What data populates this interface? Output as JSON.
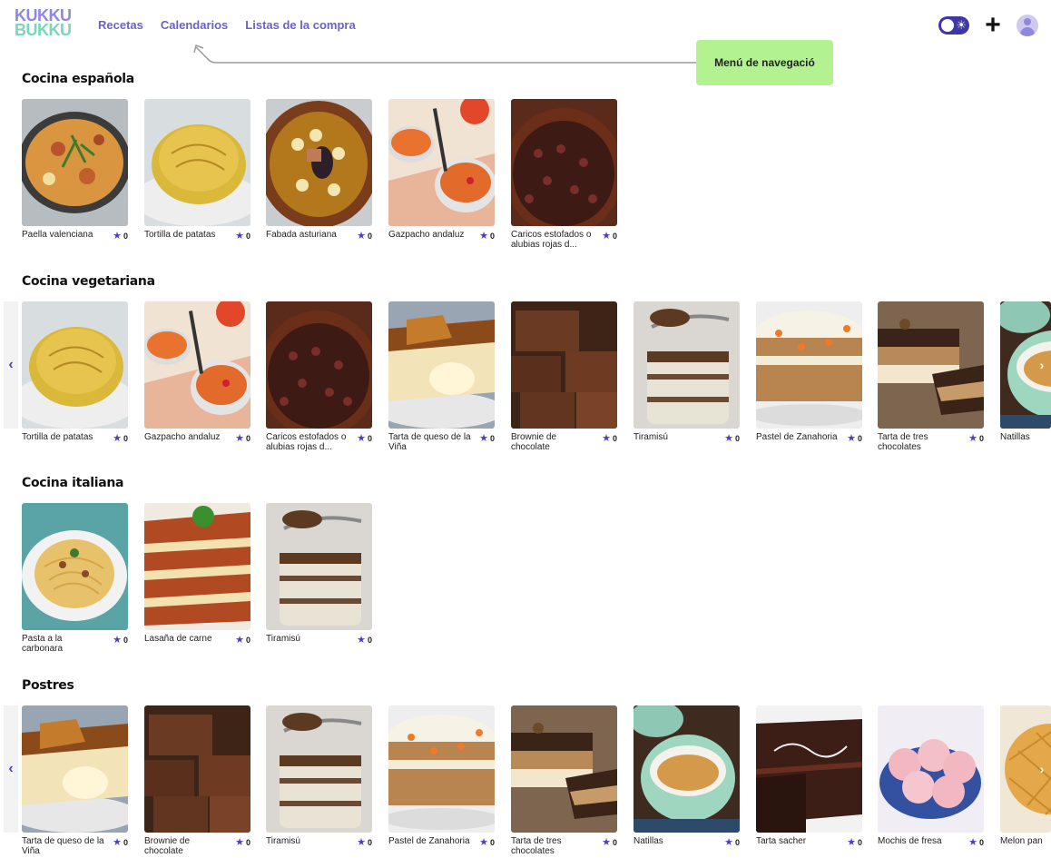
{
  "app": {
    "logo_line1": "KUKKU",
    "logo_line2": "BUKKU"
  },
  "nav": {
    "recipes": "Recetas",
    "calendars": "Calendarios",
    "shopping": "Listas de la compra"
  },
  "annotation": {
    "text": "Menú de navegació"
  },
  "colors": {
    "accent": "#6b62c9",
    "star": "#4b3fc2",
    "annotation_bg": "#b4f291",
    "logo_top": "#8f88e0",
    "logo_bottom": "#7ad6b8"
  },
  "sections": [
    {
      "title": "Cocina española",
      "has_arrows": false,
      "items": [
        {
          "name": "Paella valenciana",
          "rating": "0",
          "img": "paella"
        },
        {
          "name": "Tortilla de patatas",
          "rating": "0",
          "img": "tortilla"
        },
        {
          "name": "Fabada asturiana",
          "rating": "0",
          "img": "fabada"
        },
        {
          "name": "Gazpacho andaluz",
          "rating": "0",
          "img": "gazpacho"
        },
        {
          "name": "Caricos estofados o alubias rojas d...",
          "rating": "0",
          "img": "caricos"
        }
      ]
    },
    {
      "title": "Cocina vegetariana",
      "has_arrows": true,
      "items": [
        {
          "name": "Tortilla de patatas",
          "rating": "0",
          "img": "tortilla"
        },
        {
          "name": "Gazpacho andaluz",
          "rating": "0",
          "img": "gazpacho"
        },
        {
          "name": "Caricos estofados o alubias rojas d...",
          "rating": "0",
          "img": "caricos"
        },
        {
          "name": "Tarta de queso de la Viña",
          "rating": "0",
          "img": "cheesecake"
        },
        {
          "name": "Brownie de chocolate",
          "rating": "0",
          "img": "brownie"
        },
        {
          "name": "Tiramisú",
          "rating": "0",
          "img": "tiramisu"
        },
        {
          "name": "Pastel de Zanahoria",
          "rating": "0",
          "img": "carrot"
        },
        {
          "name": "Tarta de tres chocolates",
          "rating": "0",
          "img": "trescho"
        },
        {
          "name": "Natillas",
          "rating": "",
          "img": "natillas"
        }
      ]
    },
    {
      "title": "Cocina italiana",
      "has_arrows": false,
      "items": [
        {
          "name": "Pasta a la carbonara",
          "rating": "0",
          "img": "pasta"
        },
        {
          "name": "Lasaña de carne",
          "rating": "0",
          "img": "lasagna"
        },
        {
          "name": "Tiramisú",
          "rating": "0",
          "img": "tiramisu"
        }
      ]
    },
    {
      "title": "Postres",
      "has_arrows": true,
      "items": [
        {
          "name": "Tarta de queso de la Viña",
          "rating": "0",
          "img": "cheesecake"
        },
        {
          "name": "Brownie de chocolate",
          "rating": "0",
          "img": "brownie"
        },
        {
          "name": "Tiramisú",
          "rating": "0",
          "img": "tiramisu"
        },
        {
          "name": "Pastel de Zanahoria",
          "rating": "0",
          "img": "carrot"
        },
        {
          "name": "Tarta de tres chocolates",
          "rating": "0",
          "img": "trescho"
        },
        {
          "name": "Natillas",
          "rating": "0",
          "img": "natillas"
        },
        {
          "name": "Tarta sacher",
          "rating": "0",
          "img": "sacher"
        },
        {
          "name": "Mochis de fresa",
          "rating": "0",
          "img": "mochi"
        },
        {
          "name": "Melon pan",
          "rating": "",
          "img": "melonpan"
        }
      ]
    }
  ]
}
